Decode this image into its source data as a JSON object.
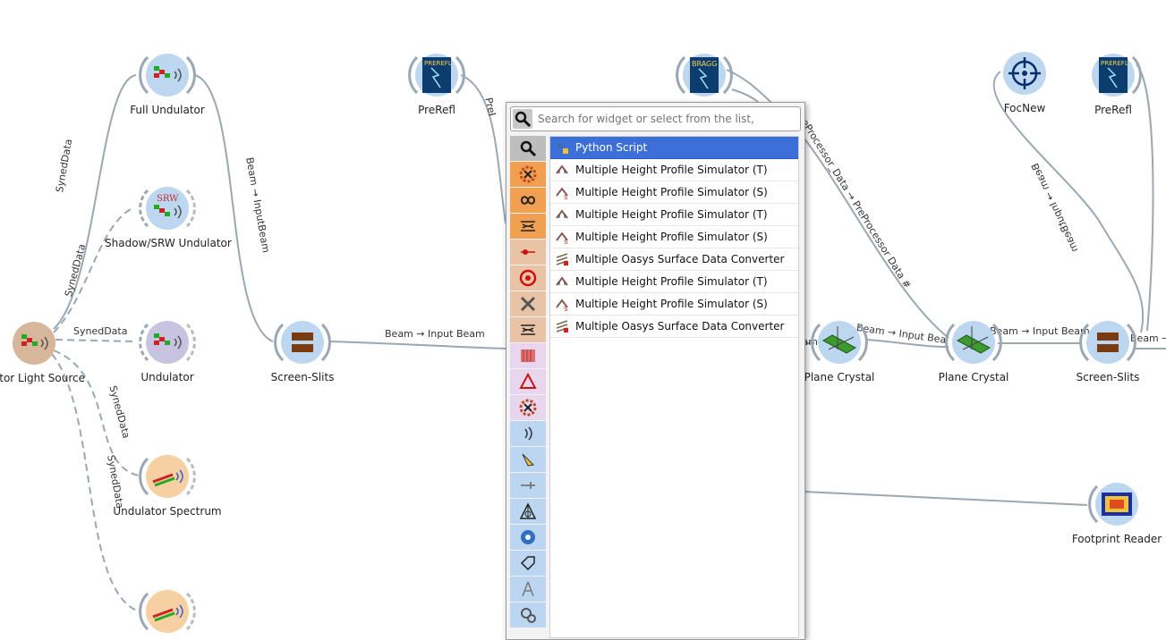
{
  "nodes": {
    "light_source": "ulator Light Source",
    "full_undulator": "Full Undulator",
    "shadow_srw_undulator": "Shadow/SRW Undulator",
    "undulator": "Undulator",
    "undulator_spectrum": "Undulator Spectrum",
    "screen_slits_1": "Screen-Slits",
    "prerefl_1": "PreRefl",
    "plane_crystal_1": "Plane Crystal",
    "plane_crystal_2": "Plane Crystal",
    "screen_slits_2": "Screen-Slits",
    "focnew": "FocNew",
    "prerefl_2": "PreRefl",
    "footprint_reader": "Footprint Reader",
    "prerefl_icon_text": "PREREFL",
    "bragg_icon_text": "BRAGG",
    "srw_icon_text": "SRW"
  },
  "edges": {
    "syned_data": "SynedData",
    "beam_input_beam": "Beam → Input Beam",
    "beam_input_beam_vertical": "Beam → InputBeam",
    "preprocessor_data": "PreProcessor_Data → PreProcessor Data #",
    "beam_input_beam_right": "Beam → Input Beam",
    "beam_arrow_partial": "Beam →",
    "beam_input_beam_rot": "Beam → InputBeam",
    "pre_frag": "PreProc",
    "pre_frag2": "PreP",
    "beam_frag": "eam",
    "beam_input_bea": "Beam → Input Bea"
  },
  "popup": {
    "search_placeholder": "Search for widget or select from the list,",
    "items": [
      {
        "label": "Python Script",
        "icon": "python-icon",
        "selected": true
      },
      {
        "label": "Multiple Height Profile Simulator (T)",
        "icon": "height-profile-t-icon"
      },
      {
        "label": "Multiple Height Profile Simulator (S)",
        "icon": "height-profile-s-icon"
      },
      {
        "label": "Multiple Height Profile Simulator (T)",
        "icon": "height-profile-t-icon"
      },
      {
        "label": "Multiple Height Profile Simulator (S)",
        "icon": "height-profile-s-icon"
      },
      {
        "label": "Multiple Oasys Surface Data Converter",
        "icon": "surface-converter-icon"
      },
      {
        "label": "Multiple Height Profile Simulator (T)",
        "icon": "height-profile-t-icon"
      },
      {
        "label": "Multiple Height Profile Simulator (S)",
        "icon": "height-profile-s-icon"
      },
      {
        "label": "Multiple Oasys Surface Data Converter",
        "icon": "surface-converter-icon"
      }
    ],
    "categories": [
      {
        "icon": "search-icon",
        "bg": "#bdbdbd"
      },
      {
        "icon": "gear-cross-icon",
        "bg": "#f0a050"
      },
      {
        "icon": "infinity-icon",
        "bg": "#f0a050"
      },
      {
        "icon": "waveguide-icon",
        "bg": "#f0a050"
      },
      {
        "icon": "laser-icon",
        "bg": "#e9c3a6"
      },
      {
        "icon": "target-icon",
        "bg": "#e9c3a6"
      },
      {
        "icon": "tools-icon",
        "bg": "#e9c3a6"
      },
      {
        "icon": "waveguide-icon",
        "bg": "#e9c3a6"
      },
      {
        "icon": "bars-icon",
        "bg": "#e8d6ef"
      },
      {
        "icon": "prism-icon",
        "bg": "#e8d6ef"
      },
      {
        "icon": "gear-cross-icon",
        "bg": "#e8d6ef"
      },
      {
        "icon": "wave-icon",
        "bg": "#bcd6f2"
      },
      {
        "icon": "lamp-icon",
        "bg": "#bcd6f2"
      },
      {
        "icon": "arrows-icon",
        "bg": "#bcd6f2"
      },
      {
        "icon": "hallows-icon",
        "bg": "#bcd6f2"
      },
      {
        "icon": "gear-blue-icon",
        "bg": "#bcd6f2"
      },
      {
        "icon": "tag-icon",
        "bg": "#bcd6f2"
      },
      {
        "icon": "compass-icon",
        "bg": "#bcd6f2"
      },
      {
        "icon": "gears-icon",
        "bg": "#bcd6f2"
      }
    ]
  },
  "colors": {
    "link": "#9aa8b3",
    "selection": "#3d6fd9",
    "node_blue": "#bdd7f1",
    "node_orange": "#f6cfa2",
    "node_tan": "#d7b79b",
    "node_purple": "#c9c3e2"
  }
}
